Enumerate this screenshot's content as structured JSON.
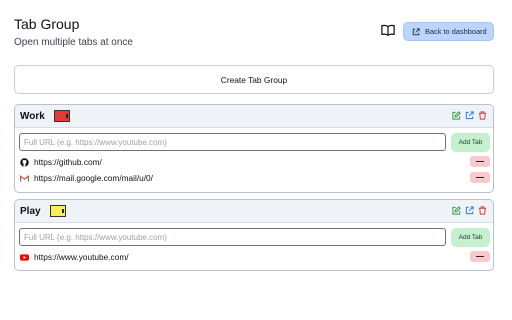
{
  "header": {
    "title": "Tab Group",
    "subtitle": "Open multiple tabs at once",
    "book_icon": "book-open-icon",
    "back_button": "Back to dashboard"
  },
  "create_button": "Create Tab Group",
  "groups": [
    {
      "name": "Work",
      "color": "#e53935",
      "actions": [
        "edit-icon",
        "open-external-icon",
        "trash-icon"
      ],
      "input_placeholder": "Full URL (e.g. https://www.youtube.com)",
      "add_button": "Add Tab",
      "tabs": [
        {
          "icon": "github-icon",
          "url": "https://github.com/"
        },
        {
          "icon": "gmail-icon",
          "url": "https://mail.google.com/mail/u/0/"
        }
      ]
    },
    {
      "name": "Play",
      "color": "#fbef57",
      "actions": [
        "edit-icon",
        "open-external-icon",
        "trash-icon"
      ],
      "input_placeholder": "Full URL (e.g. https://www.youtube.com)",
      "add_button": "Add Tab",
      "tabs": [
        {
          "icon": "youtube-icon",
          "url": "https://www.youtube.com/"
        }
      ]
    }
  ],
  "colors": {
    "accent_blue": "#bcd5fb",
    "add_green": "#c4f0cf",
    "remove_red": "#f7c9cc",
    "edit_green": "#2e9a4a",
    "open_blue": "#2f7fd8",
    "delete_red": "#d93a3a"
  }
}
